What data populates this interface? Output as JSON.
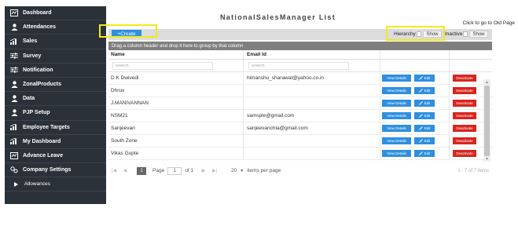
{
  "sidebar": {
    "items": [
      {
        "label": "Dashboard",
        "icon": "dashboard-icon"
      },
      {
        "label": "Attendances",
        "icon": "user-icon"
      },
      {
        "label": "Sales",
        "icon": "chart-icon"
      },
      {
        "label": "Survey",
        "icon": "sliders-icon"
      },
      {
        "label": "Notification",
        "icon": "sliders-icon"
      },
      {
        "label": "ZonalProducts",
        "icon": "user-icon"
      },
      {
        "label": "Data",
        "icon": "user-icon"
      },
      {
        "label": "PJP Setup",
        "icon": "user-icon"
      },
      {
        "label": "Employee Targets",
        "icon": "chart-icon"
      },
      {
        "label": "My Dashboard",
        "icon": "chart-icon"
      },
      {
        "label": "Advance Leave",
        "icon": "dashboard-icon"
      },
      {
        "label": "Company Settings",
        "icon": "settings-icon"
      },
      {
        "label": "Allowances",
        "icon": "caret-right-icon"
      }
    ]
  },
  "header": {
    "title": "NationalSalesManager List",
    "old_page_link": "Click to go to Old Page"
  },
  "toolbar": {
    "create_label": "+Create",
    "hierarchy_label": "Hierarchy :",
    "hierarchy_show": "Show",
    "inactive_label": "Inactive :",
    "inactive_show": "Show"
  },
  "grid": {
    "group_hint": "Drag a column header and drop it here to group by that column",
    "columns": [
      "Name",
      "Email Id"
    ],
    "search_placeholder": "search..",
    "view_label": "View Details",
    "edit_label": "Edit",
    "deactivate_label": "Deactivate",
    "rows": [
      {
        "name": "D K Dwivedi",
        "email": "himanshu_sharawat@yahoo.co.in"
      },
      {
        "name": "Dhruv",
        "email": ""
      },
      {
        "name": "J.MANIVANNAN",
        "email": ""
      },
      {
        "name": "NSM21",
        "email": "samsple@gmail.com"
      },
      {
        "name": "Sanjeevan",
        "email": "sanjeevanchla@gmail.com"
      },
      {
        "name": "South Zone",
        "email": ""
      },
      {
        "name": "Vikas Gupte",
        "email": ""
      }
    ]
  },
  "pager": {
    "current_page": "1",
    "page_label": "Page",
    "page_value": "1",
    "of_label": "of 1",
    "page_size": "20",
    "items_per_page": "items per page",
    "info": "1 - 7 of 7 items"
  },
  "colors": {
    "sidebar_bg": "#2b3138",
    "primary": "#2e8fe0",
    "danger": "#d9241e",
    "highlight": "#f3e91a"
  }
}
